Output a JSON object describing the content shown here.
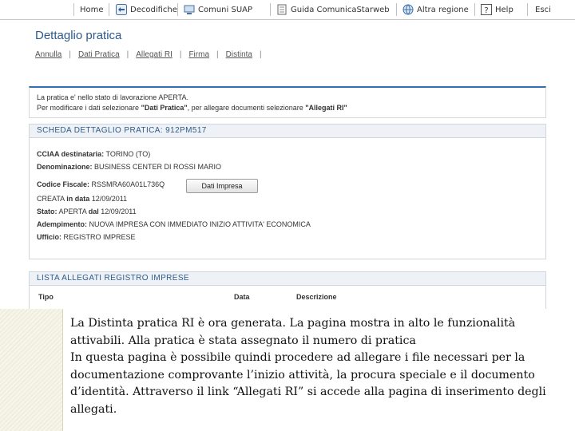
{
  "toolbar": {
    "items": [
      {
        "label": "Home",
        "icon": "home-icon"
      },
      {
        "label": "Decodifiche",
        "icon": "decode-arrows-icon"
      },
      {
        "label": "Comuni SUAP",
        "icon": "computer-icon"
      },
      {
        "label": "Guida ComunicaStarweb",
        "icon": "book-icon"
      },
      {
        "label": "Altra regione",
        "icon": "globe-icon"
      },
      {
        "label": "Help",
        "icon": "help-icon"
      },
      {
        "label": "Esci",
        "icon": ""
      }
    ]
  },
  "page": {
    "title": "Dettaglio pratica",
    "subnav": [
      "Annulla",
      "Dati Pratica",
      "Allegati RI",
      "Firma",
      "Distinta"
    ]
  },
  "info": {
    "line1": "La pratica e' nello stato di lavorazione APERTA.",
    "line2_prefix": "Per modificare i dati selezionare ",
    "line2_bold1": "\"Dati Pratica\"",
    "line2_mid": ", per allegare documenti selezionare ",
    "line2_bold2": "\"Allegati RI\""
  },
  "detail": {
    "header": "SCHEDA DETTAGLIO PRATICA: 912PM517",
    "cciaa_label": "CCIAA destinataria:",
    "cciaa_value": "TORINO (TO)",
    "denominazione_label": "Denominazione:",
    "denominazione_value": "BUSINESS CENTER DI ROSSI MARIO",
    "codice_label": "Codice Fiscale:",
    "codice_value": "RSSMRA60A01L736Q",
    "dati_impresa_button": "Dati Impresa",
    "creata_prefix": "CREATA",
    "creata_label": "in data",
    "creata_value": "12/09/2011",
    "stato_label": "Stato:",
    "stato_value": "APERTA",
    "stato_dal": "dal",
    "stato_date": "12/09/2011",
    "adempimento_label": "Adempimento:",
    "adempimento_value": "NUOVA IMPRESA CON IMMEDIATO INIZIO ATTIVITA' ECONOMICA",
    "ufficio_label": "Ufficio:",
    "ufficio_value": "REGISTRO IMPRESE"
  },
  "attachments": {
    "header": "LISTA ALLEGATI REGISTRO IMPRESE",
    "columns": [
      "Tipo",
      "Data",
      "Descrizione"
    ]
  },
  "caption": {
    "paragraph1": "La Distinta pratica RI è ora generata. La pagina mostra in alto le funzionalità attivabili. Alla pratica è stata assegnato il numero di pratica",
    "paragraph2": "In questa pagina è possibile quindi procedere ad allegare i file necessari per la documentazione comprovante l’inizio attività, la procura speciale e il documento d’identità. Attraverso il link “Allegati RI” si accede alla pagina di inserimento degli allegati."
  }
}
